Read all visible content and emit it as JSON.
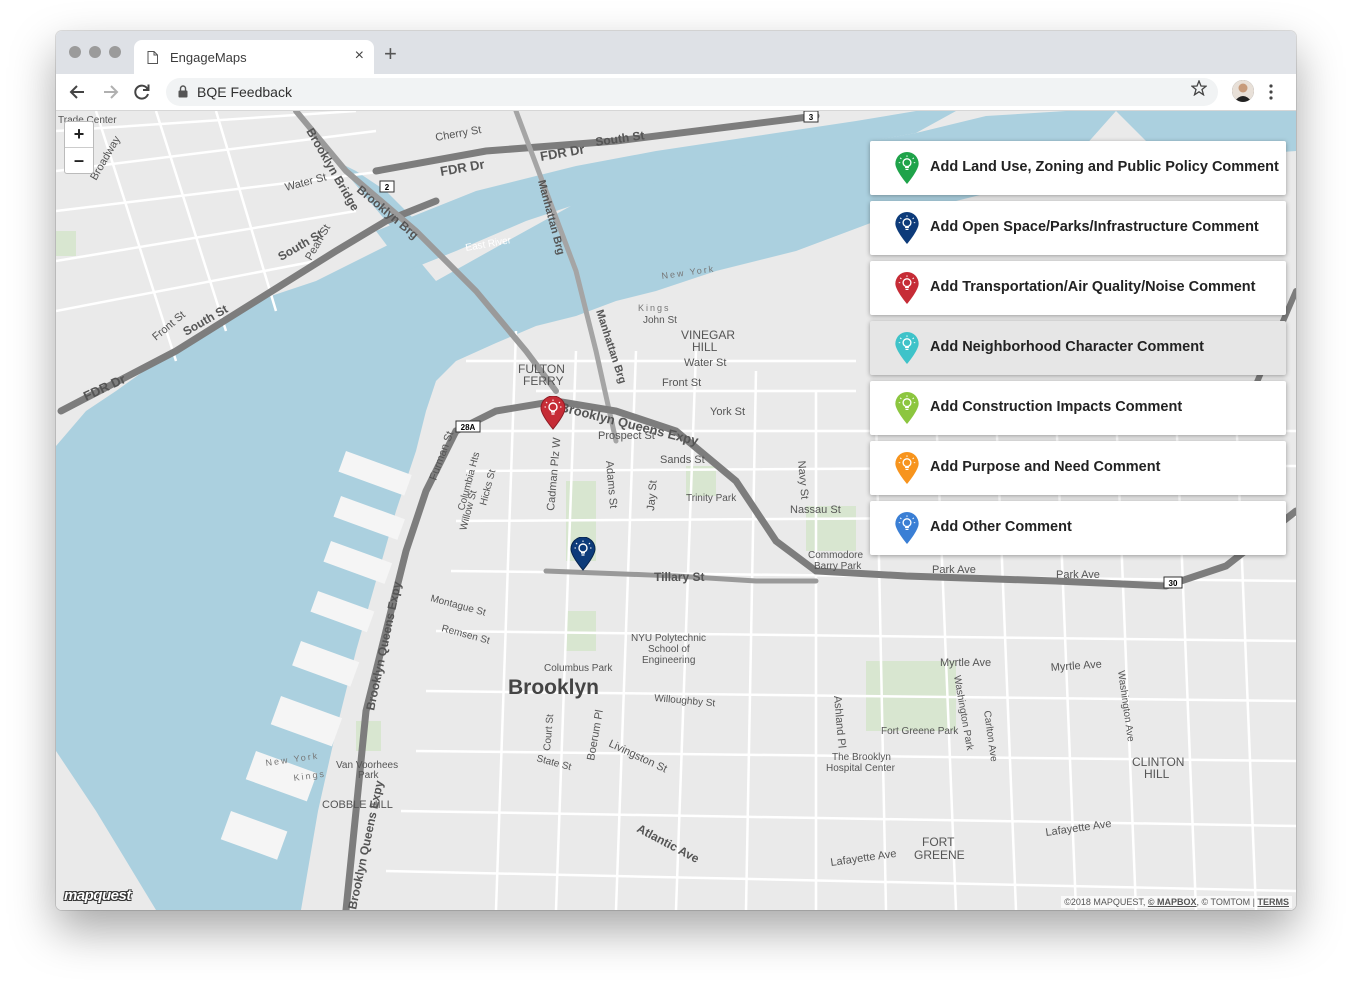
{
  "browser": {
    "tab_title": "EngageMaps",
    "tab_close": "×",
    "new_tab": "+",
    "url": "BQE Feedback"
  },
  "map": {
    "zoom_in": "+",
    "zoom_out": "–",
    "logo": "mapquest",
    "attribution": {
      "copyright": "©2018 MAPQUEST, ",
      "mapbox": "© MAPBOX",
      "tomtom": ", © TOMTOM | ",
      "terms": "TERMS"
    },
    "labels": {
      "fdr_dr_1": "FDR Dr",
      "fdr_dr_2": "FDR Dr",
      "fdr_dr_3": "FDR Dr",
      "south_st_1": "South St",
      "south_st_2": "South St",
      "south_st_3": "South St",
      "brooklyn_bridge": "Brooklyn Bridge",
      "brooklyn_brg": "Brooklyn Brg",
      "manhattan_brg": "Manhattan Brg",
      "manhattan_brg_2": "Manhattan Brg",
      "cherry_st": "Cherry St",
      "pearl_st": "Pearl St",
      "water_st": "Water St",
      "front_st": "Front St",
      "john_st": "John St",
      "vinegar_hill": "VINEGAR",
      "vinegar_hill_2": "HILL",
      "water_st_bk": "Water St",
      "front_st_bk": "Front St",
      "york_st": "York St",
      "fulton_ferry": "FULTON",
      "fulton_ferry_2": "FERRY",
      "bqe_1": "Brooklyn Queens Expy",
      "bqe_2": "Brooklyn Queens Expy",
      "bqe_3": "Brooklyn Queens Expy",
      "prospect_st": "Prospect St",
      "sands_st": "Sands St",
      "trinity_park": "Trinity Park",
      "nassau_st": "Nassau St",
      "commodore_1": "Commodore",
      "commodore_2": "Barry Park",
      "park_ave": "Park Ave",
      "park_ave_2": "Park Ave",
      "tillary_st": "Tillary St",
      "cadman_plz": "Cadman Plz W",
      "adams_st": "Adams St",
      "jay_st": "Jay St",
      "navy_st": "Navy St",
      "furman_st": "Furman St",
      "columbia_hts": "Columbia Hts",
      "willow_st": "Willow St",
      "hicks_st": "Hicks St",
      "montague_st": "Montague St",
      "remsen_st": "Remsen St",
      "nyu_1": "NYU Polytechnic",
      "nyu_2": "School of",
      "nyu_3": "Engineering",
      "columbus_park": "Columbus Park",
      "brooklyn": "Brooklyn",
      "willoughby_st": "Willoughby St",
      "myrtle_ave": "Myrtle Ave",
      "myrtle_ave_2": "Myrtle Ave",
      "fort_greene_park": "Fort Greene Park",
      "brooklyn_hospital_1": "The Brooklyn",
      "brooklyn_hospital_2": "Hospital Center",
      "livingston_st": "Livingston St",
      "state_st": "State St",
      "atlantic_ave": "Atlantic Ave",
      "lafayette_ave": "Lafayette Ave",
      "lafayette_ave_2": "Lafayette Ave",
      "fort_greene_1": "FORT",
      "fort_greene_2": "GREENE",
      "clinton_hill_1": "CLINTON",
      "clinton_hill_2": "HILL",
      "cobble_hill": "COBBLE HILL",
      "van_voorhees_1": "Van Voorhees",
      "van_voorhees_2": "Park",
      "boerum_pl": "Boerum Pl",
      "court_st": "Court St",
      "ashland_pl": "Ashland Pl",
      "washington_park": "Washington Park",
      "carlton_ave": "Carlton Ave",
      "washington_ave": "Washington Ave",
      "east_river": "East River",
      "new_york": "New York",
      "new_york_2": "New York",
      "kings": "Kings",
      "kings_2": "Kings",
      "shield_28a": "28A",
      "shield_2": "2",
      "shield_3": "3",
      "shield_30": "30",
      "trade_center": "Trade Center",
      "broadway": "Broadway"
    }
  },
  "comment_buttons": [
    {
      "label": "Add Land Use, Zoning and Public Policy Comment",
      "color": "#1fa34a"
    },
    {
      "label": "Add Open Space/Parks/Infrastructure Comment",
      "color": "#0d3b7a"
    },
    {
      "label": "Add Transportation/Air Quality/Noise Comment",
      "color": "#c62c36"
    },
    {
      "label": "Add Neighborhood Character Comment",
      "color": "#3fc3c9"
    },
    {
      "label": "Add Construction Impacts Comment",
      "color": "#8cc63f"
    },
    {
      "label": "Add Purpose and Need Comment",
      "color": "#f7941d"
    },
    {
      "label": "Add Other Comment",
      "color": "#3a7fd5"
    }
  ],
  "markers": [
    {
      "category": "Transportation/Air Quality/Noise",
      "color": "#c62c36"
    },
    {
      "category": "Open Space/Parks/Infrastructure",
      "color": "#0d3b7a"
    }
  ]
}
